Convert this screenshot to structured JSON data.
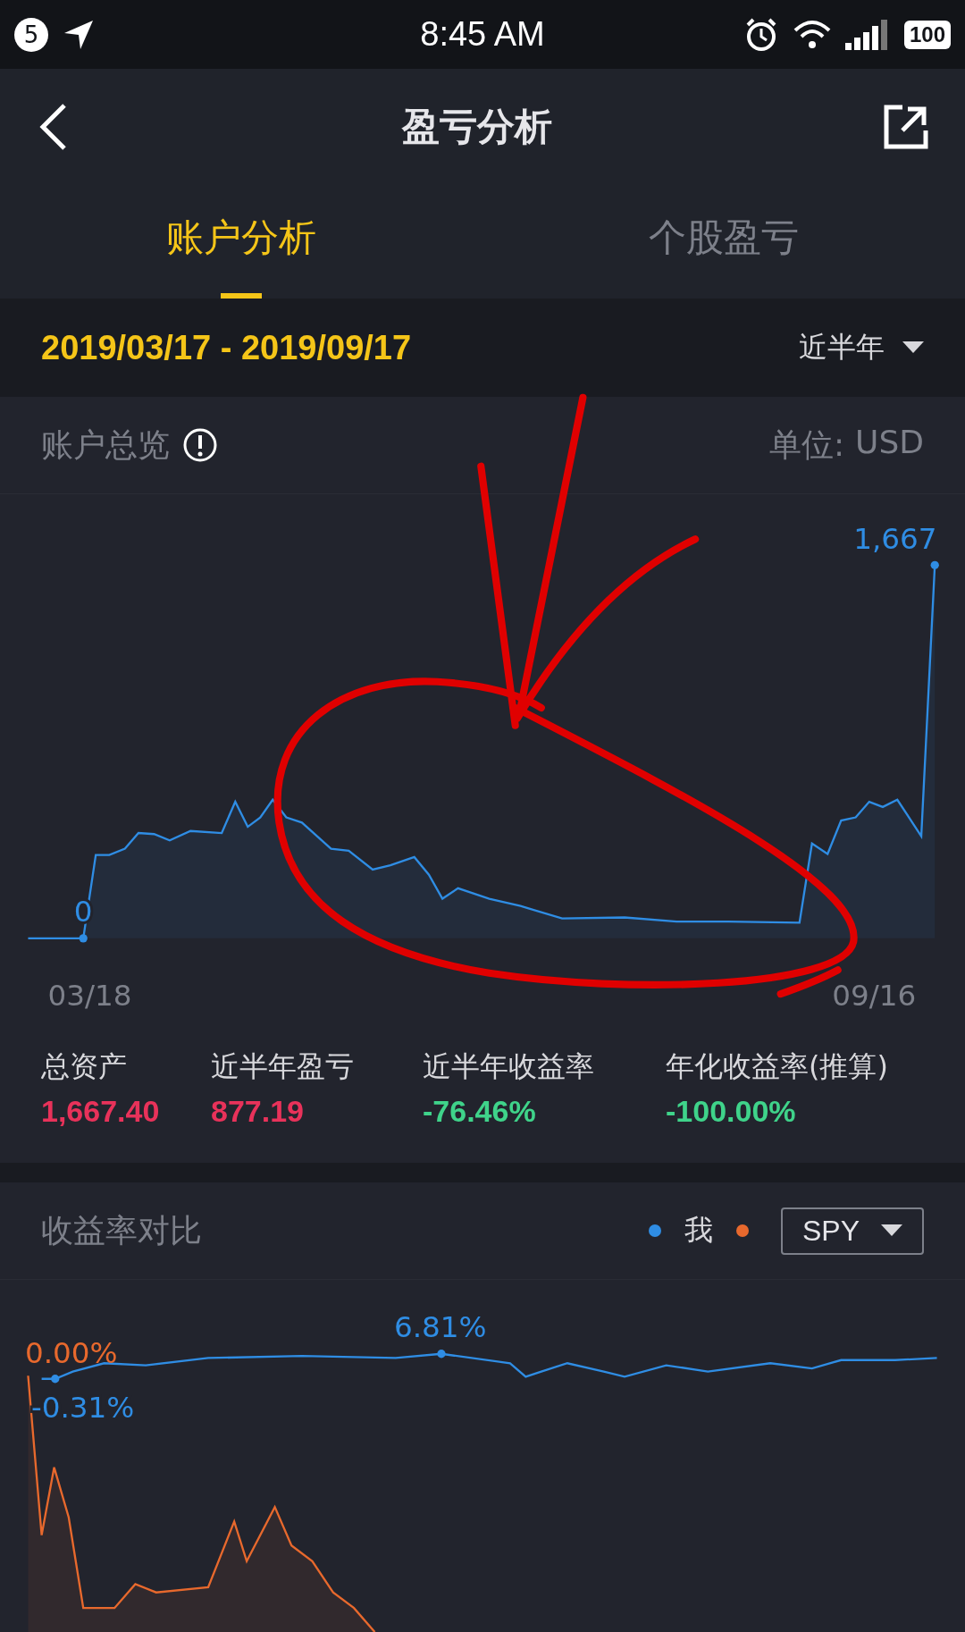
{
  "status_bar": {
    "notification_count": "5",
    "time": "8:45 AM",
    "battery": "100"
  },
  "header": {
    "title": "盈亏分析"
  },
  "tabs": [
    {
      "label": "账户分析",
      "selected": true
    },
    {
      "label": "个股盈亏",
      "selected": false
    }
  ],
  "date_range": {
    "range": "2019/03/17 - 2019/09/17",
    "period": "近半年"
  },
  "overview": {
    "title": "账户总览",
    "unit_label": "单位:",
    "unit": "USD",
    "chart_labels": {
      "end_value": "1,667",
      "start_value": "0",
      "start_date": "03/18",
      "end_date": "09/16"
    },
    "stats": [
      {
        "label": "总资产",
        "value": "1,667.40",
        "color": "#e8325a"
      },
      {
        "label": "近半年盈亏",
        "value": "877.19",
        "color": "#e8325a"
      },
      {
        "label": "近半年收益率",
        "value": "-76.46%",
        "color": "#3fd38a"
      },
      {
        "label": "年化收益率(推算)",
        "value": "-100.00%",
        "color": "#3fd38a"
      }
    ]
  },
  "comparison": {
    "title": "收益率对比",
    "legend": [
      {
        "label": "我",
        "color": "#2f8de4"
      },
      {
        "color": "#e8692d"
      }
    ],
    "benchmark": "SPY",
    "chart_labels": {
      "benchmark_start": "0.00%",
      "my_start": "-0.31%",
      "my_peak": "6.81%"
    }
  },
  "annotation": {
    "kind": "arrow-and-circle"
  }
}
